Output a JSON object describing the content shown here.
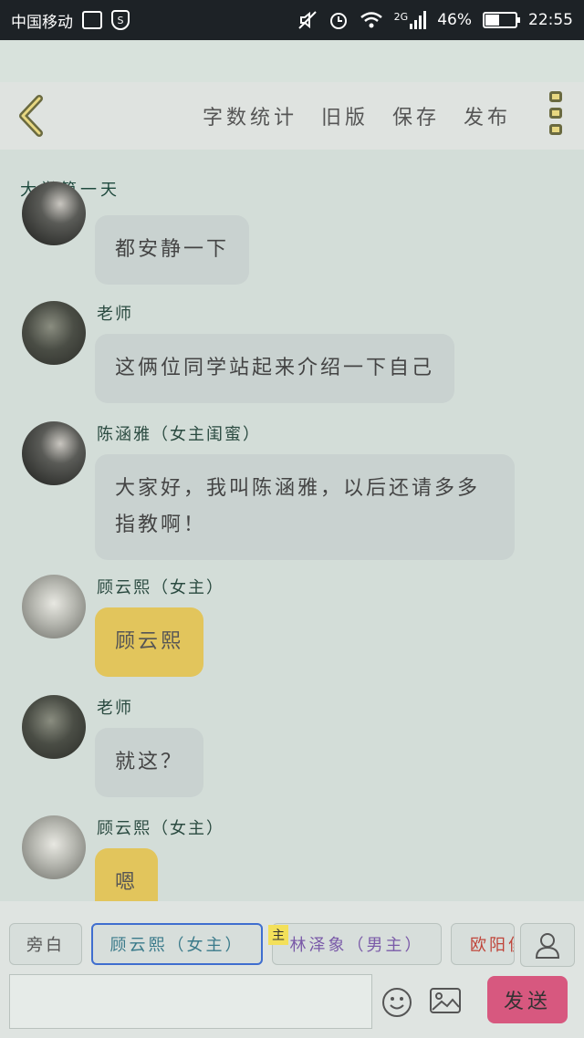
{
  "status_bar": {
    "carrier": "中国移动",
    "network": "2G",
    "battery_percent": "46%",
    "battery_level": 0.46,
    "time": "22:55"
  },
  "toolbar": {
    "word_count": "字数统计",
    "old_version": "旧版",
    "save": "保存",
    "publish": "发布"
  },
  "chat": {
    "chapter_title": "大学第一天",
    "messages": [
      {
        "speaker": "",
        "text": "都安静一下",
        "style": "gray"
      },
      {
        "speaker": "老师",
        "text": "这俩位同学站起来介绍一下自己",
        "style": "gray"
      },
      {
        "speaker": "陈涵雅（女主闺蜜）",
        "text": "大家好，我叫陈涵雅，以后还请多多指教啊！",
        "style": "gray"
      },
      {
        "speaker": "顾云熙（女主）",
        "text": "顾云熙",
        "style": "gold"
      },
      {
        "speaker": "老师",
        "text": "就这？",
        "style": "gray"
      },
      {
        "speaker": "顾云熙（女主）",
        "text": "嗯",
        "style": "gold"
      }
    ]
  },
  "roles": {
    "narration": "旁白",
    "role1": "顾云熙（女主）",
    "role2_tag": "主",
    "role2": "林泽象（男主）",
    "role3": "欧阳俊"
  },
  "input": {
    "placeholder": "",
    "send": "发送"
  },
  "colors": {
    "accent_gold": "#e2c55c",
    "send_button": "#d7587f",
    "selected_border": "#3f6ecf",
    "role1_text": "#3a7a8a",
    "role2_text": "#7a5aa8",
    "role3_text": "#c0453a"
  }
}
